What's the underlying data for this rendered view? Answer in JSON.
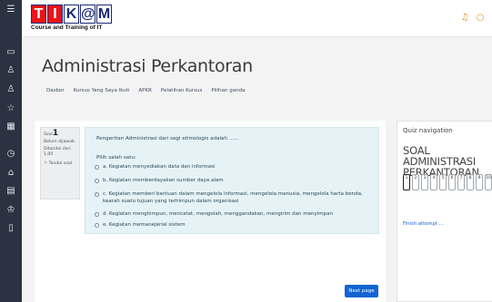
{
  "header": {
    "logo_letters": [
      "T",
      "I",
      "K",
      "@",
      "M"
    ],
    "logo_subtitle": "Course and Training of IT",
    "bell_icon": "bell-icon",
    "chat_icon": "chat-bubble-icon"
  },
  "sidebar": {
    "icons": [
      "menu-icon",
      "folder-icon",
      "people-icon",
      "person-icon",
      "star-icon",
      "book-icon",
      "timer-icon",
      "home-icon",
      "calendar-icon",
      "graduation-cap-icon",
      "document-icon"
    ]
  },
  "page": {
    "title": "Administrasi Perkantoran",
    "breadcrumb": [
      "Dasbor",
      "Kursus Yang Saya Ikuti",
      "APKR",
      "Pelatihan Kursus",
      "Pilihan ganda"
    ]
  },
  "question_info": {
    "label": "Soal",
    "number": "1",
    "status": "Belum dijawab",
    "points": "Ditandai dari 1,00",
    "flag_label": "Tandai soal"
  },
  "question": {
    "text": "Pengertian Administrasi dari segi etimologis adalah ......",
    "prompt": "Pilih salah satu:",
    "options": [
      "a. Kegiatan menyediakan data dan informasi",
      "b. Kegiatan memberdayakan sumber daya alam",
      "c. Kegiatan memberi bantuan dalam mengelola informasi, mengelola manusia, mengelola harta benda,",
      "kearah suatu tujuan yang terhimpun dalam organisasi",
      "d. Kegiatan menghimpun, mencatat, mengolah, menggandakan, mengirim dan menyimpan",
      "e. Kegiatan memanejerial sistem"
    ],
    "next_label": "Next page"
  },
  "quiz_nav": {
    "heading": "Quiz navigation",
    "title": "SOAL ADMINISTRASI PERKANTORAN",
    "buttons": [
      "1",
      "2",
      "3",
      "4",
      "5",
      "6",
      "7",
      "8",
      "9",
      "10"
    ],
    "current": "1",
    "finish_label": "Finish attempt ..."
  },
  "colors": {
    "sidebar": "#2b3342",
    "accent_blue": "#1164d2",
    "question_bg": "#e5f2f6",
    "logo_red": "#e8141a",
    "logo_navy": "#1b2a77",
    "header_icon": "#e3902a"
  }
}
